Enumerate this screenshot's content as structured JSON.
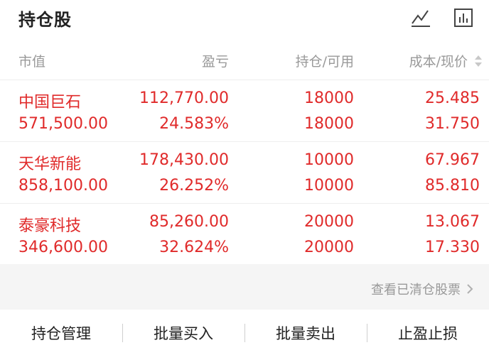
{
  "header": {
    "title": "持仓股",
    "icons": [
      "trend-line-icon",
      "bar-chart-icon"
    ]
  },
  "columns": {
    "market_value": "市值",
    "profit_loss": "盈亏",
    "position_available": "持仓/可用",
    "cost_price": "成本/现价"
  },
  "holdings": [
    {
      "name": "中国巨石",
      "market_value": "571,500.00",
      "profit": "112,770.00",
      "profit_pct": "24.583%",
      "position": "18000",
      "available": "18000",
      "cost": "25.485",
      "price": "31.750"
    },
    {
      "name": "天华新能",
      "market_value": "858,100.00",
      "profit": "178,430.00",
      "profit_pct": "26.252%",
      "position": "10000",
      "available": "10000",
      "cost": "67.967",
      "price": "85.810"
    },
    {
      "name": "泰豪科技",
      "market_value": "346,600.00",
      "profit": "85,260.00",
      "profit_pct": "32.624%",
      "position": "20000",
      "available": "20000",
      "cost": "13.067",
      "price": "17.330"
    }
  ],
  "cleared_link": "查看已清仓股票",
  "bottom_actions": {
    "manage": "持仓管理",
    "batch_buy": "批量买入",
    "batch_sell": "批量卖出",
    "stop": "止盈止损"
  },
  "colors": {
    "gain": "#e02a2a",
    "muted": "#999999",
    "text": "#222222"
  }
}
